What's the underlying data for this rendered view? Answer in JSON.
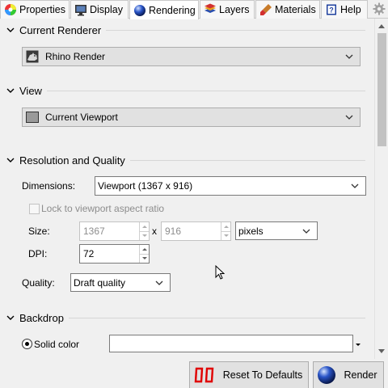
{
  "tabs": [
    {
      "label": "Properties",
      "icon": "properties-color-wheel-icon"
    },
    {
      "label": "Display",
      "icon": "display-monitor-icon"
    },
    {
      "label": "Rendering",
      "icon": "rendering-sphere-icon",
      "active": true
    },
    {
      "label": "Layers",
      "icon": "layers-icon"
    },
    {
      "label": "Materials",
      "icon": "materials-brush-icon"
    },
    {
      "label": "Help",
      "icon": "help-book-icon"
    }
  ],
  "sections": {
    "current_renderer": {
      "title": "Current Renderer",
      "value": "Rhino Render"
    },
    "view": {
      "title": "View",
      "value": "Current Viewport"
    },
    "resolution": {
      "title": "Resolution and Quality",
      "dimensions_label": "Dimensions:",
      "dimensions_value": "Viewport (1367 x 916)",
      "lock_aspect_label": "Lock to viewport aspect ratio",
      "lock_aspect_checked": false,
      "size_label": "Size:",
      "width": "1367",
      "times": "x",
      "height": "916",
      "units": "pixels",
      "dpi_label": "DPI:",
      "dpi": "72",
      "quality_label": "Quality:",
      "quality": "Draft quality"
    },
    "backdrop": {
      "title": "Backdrop",
      "solid_color_label": "Solid color",
      "solid_color_selected": true,
      "color": "#ffffff"
    }
  },
  "buttons": {
    "reset_label": "Reset To Defaults",
    "render_label": "Render"
  },
  "colors": {
    "accent_blue": "#1e3c9a",
    "reset_red": "#e00000"
  }
}
